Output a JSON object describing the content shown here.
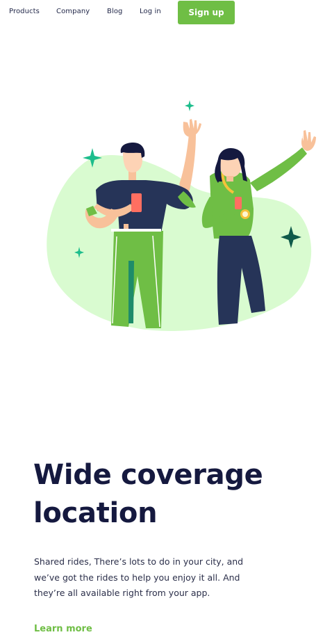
{
  "nav": {
    "items": [
      "Products",
      "Company",
      "Blog",
      "Log in"
    ],
    "signup_label": "Sign up"
  },
  "content": {
    "title_line1": "Wide coverage",
    "title_line2": "location",
    "description": "Shared rides, There’s lots to do in your city, and we’ve got the rides to help you enjoy it all. And they’re all available right from your app.",
    "learn_more": "Learn more"
  },
  "colors": {
    "accent": "#6fbe45",
    "heading": "#15193f",
    "blob": "#d9fbd0",
    "navy": "#263458",
    "sparkle_teal": "#1dbd8c",
    "sparkle_dark": "#0f5a4a"
  }
}
